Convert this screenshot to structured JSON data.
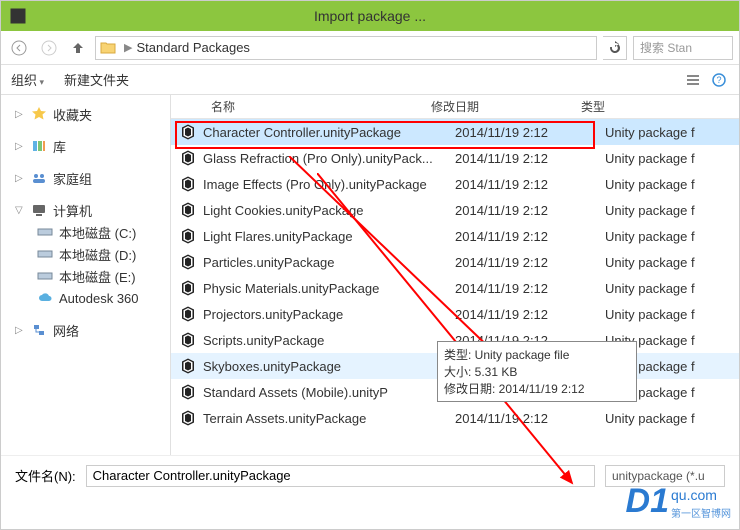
{
  "titlebar": {
    "title": "Import package ..."
  },
  "navbar": {
    "breadcrumb": "Standard Packages",
    "search_placeholder": "搜索 Stan"
  },
  "toolbar": {
    "organize": "组织",
    "new_folder": "新建文件夹"
  },
  "sidebar": {
    "favorites": "收藏夹",
    "libraries": "库",
    "homegroup": "家庭组",
    "computer": "计算机",
    "drives": [
      "本地磁盘 (C:)",
      "本地磁盘 (D:)",
      "本地磁盘 (E:)",
      "Autodesk 360"
    ],
    "network": "网络"
  },
  "columns": {
    "name": "名称",
    "date": "修改日期",
    "type": "类型"
  },
  "files": [
    {
      "name": "Character Controller.unityPackage",
      "date": "2014/11/19 2:12",
      "type": "Unity package f",
      "sel": true
    },
    {
      "name": "Glass Refraction (Pro Only).unityPack...",
      "date": "2014/11/19 2:12",
      "type": "Unity package f"
    },
    {
      "name": "Image Effects (Pro Only).unityPackage",
      "date": "2014/11/19 2:12",
      "type": "Unity package f"
    },
    {
      "name": "Light Cookies.unityPackage",
      "date": "2014/11/19 2:12",
      "type": "Unity package f"
    },
    {
      "name": "Light Flares.unityPackage",
      "date": "2014/11/19 2:12",
      "type": "Unity package f"
    },
    {
      "name": "Particles.unityPackage",
      "date": "2014/11/19 2:12",
      "type": "Unity package f"
    },
    {
      "name": "Physic Materials.unityPackage",
      "date": "2014/11/19 2:12",
      "type": "Unity package f"
    },
    {
      "name": "Projectors.unityPackage",
      "date": "2014/11/19 2:12",
      "type": "Unity package f"
    },
    {
      "name": "Scripts.unityPackage",
      "date": "2014/11/19 2:12",
      "type": "Unity package f"
    },
    {
      "name": "Skyboxes.unityPackage",
      "date": "",
      "type": "Unity package f",
      "hover": true
    },
    {
      "name": "Standard Assets (Mobile).unityP",
      "date": "",
      "type": "Unity package f"
    },
    {
      "name": "Terrain Assets.unityPackage",
      "date": "2014/11/19 2:12",
      "type": "Unity package f"
    }
  ],
  "tooltip": {
    "line1": "类型: Unity package file",
    "line2": "大小: 5.31 KB",
    "line3": "修改日期: 2014/11/19 2:12"
  },
  "footer": {
    "label": "文件名(N):",
    "value": "Character Controller.unityPackage",
    "filter": "unitypackage (*.u"
  },
  "watermark": {
    "d1": "D1",
    "domain": "qu.com",
    "cn": "第一区智博网"
  }
}
